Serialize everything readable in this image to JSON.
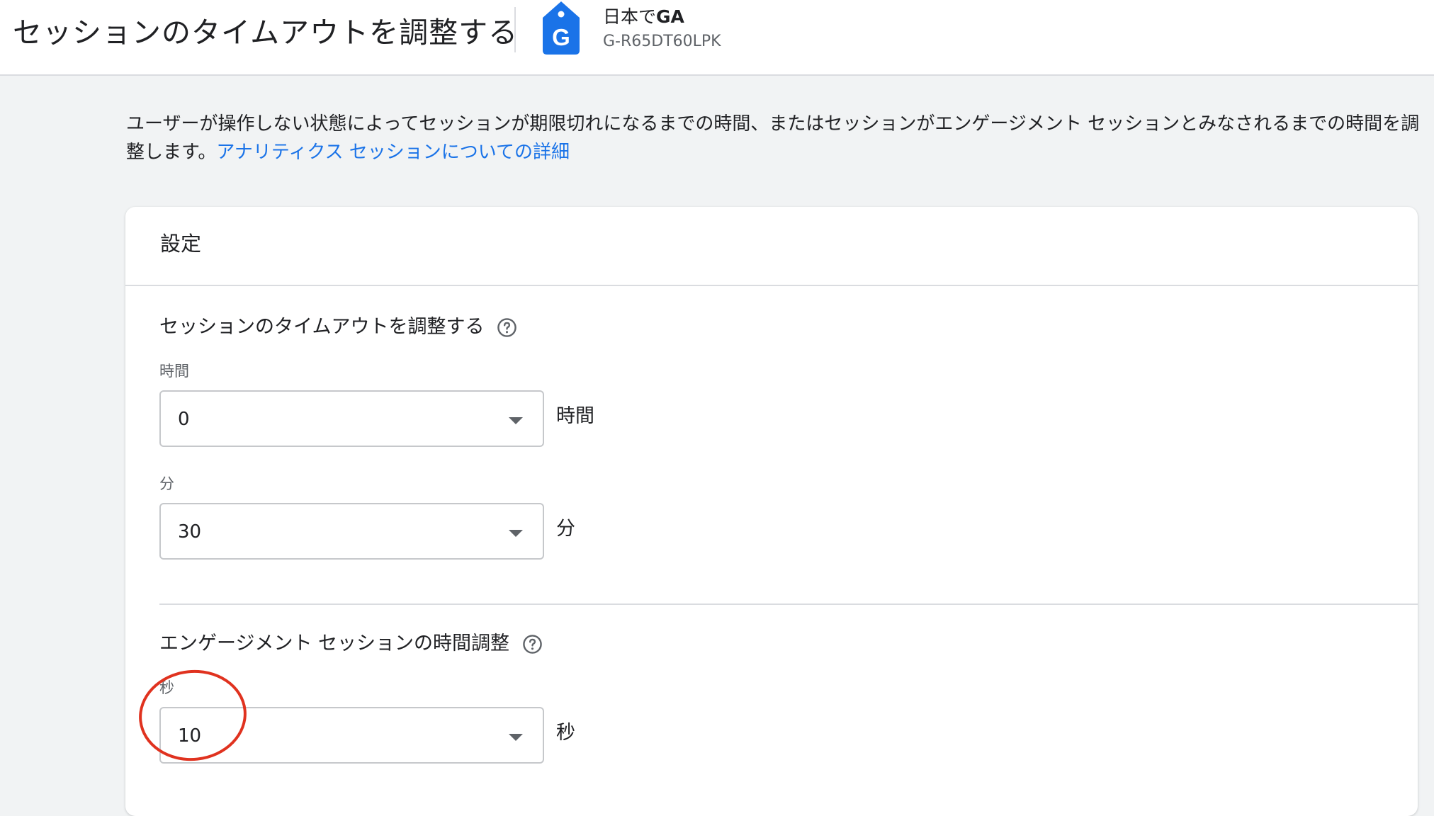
{
  "header": {
    "title": "セッションのタイムアウトを調整する",
    "property_name_prefix": "日本で",
    "property_name_bold": "GA",
    "property_id": "G-R65DT60LPK",
    "property_icon": "tag-g-icon",
    "property_icon_letter": "G"
  },
  "description": {
    "text": "ユーザーが操作しない状態によってセッションが期限切れになるまでの時間、またはセッションがエンゲージメント セッションとみなされるまでの時間を調整します。",
    "link": "アナリティクス セッションについての詳細"
  },
  "card": {
    "title": "設定",
    "session_timeout": {
      "title": "セッションのタイムアウトを調整する",
      "hours": {
        "label": "時間",
        "value": "0",
        "unit": "時間"
      },
      "minutes": {
        "label": "分",
        "value": "30",
        "unit": "分"
      }
    },
    "engaged_session": {
      "title": "エンゲージメント セッションの時間調整",
      "seconds": {
        "label": "秒",
        "value": "10",
        "unit": "秒"
      }
    }
  },
  "colors": {
    "link": "#1a73e8",
    "tag_icon": "#1a73e8",
    "highlight": "#e0321f",
    "background": "#f1f3f4"
  }
}
